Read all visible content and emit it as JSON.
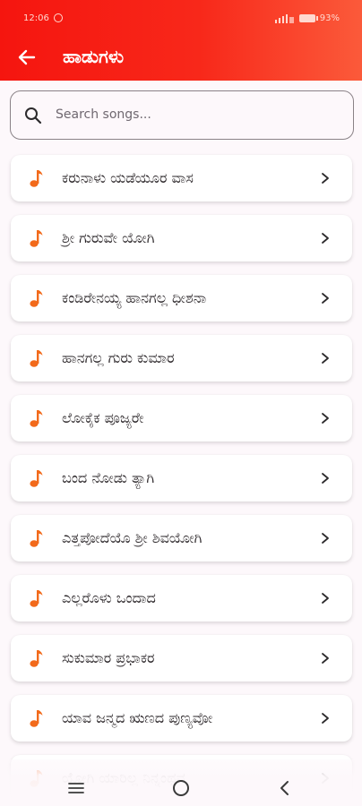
{
  "status_bar": {
    "time": "12:06",
    "battery": "93%"
  },
  "app_bar": {
    "back_icon": "arrow-left-icon",
    "title": "ಹಾಡುಗಳು"
  },
  "search": {
    "placeholder": "Search songs..."
  },
  "songs": [
    "ಕರುನಾಳು ಯಡೆಯೂರ ವಾಸ",
    "ಶ್ರೀ ಗುರುವೇ ಯೋಗಿ",
    "ಕಂಡಿರೇನಯ್ಯ ಹಾನಗಲ್ಲ ಧೀಶನಾ",
    "ಹಾನಗಲ್ಲ ಗುರು ಕುಮಾರ",
    "ಲೋಕೈಕ ಪೂಜ್ಯರೇ",
    "ಬಂದ ನೋಡು ತ್ಯಾಗಿ",
    "ಎತ್ತಪೋದೆಯೊ ಶ್ರೀ ಶಿವಯೋಗಿ",
    "ಎಲ್ಲರೊಳು ಒಂದಾದ",
    "ಸುಕುಮಾರ ಪ್ರಭಾಕರ",
    "ಯಾವ ಜನ್ಮದ ಋಣದ ಪುಣ್ಯವೋ",
    "ಯೋಗಿ ಯಾರಿಲ್ಲ ನಿನ್ನಂಥವ"
  ],
  "colors": {
    "accent": "#f5150f",
    "note": "#f26a1b"
  }
}
